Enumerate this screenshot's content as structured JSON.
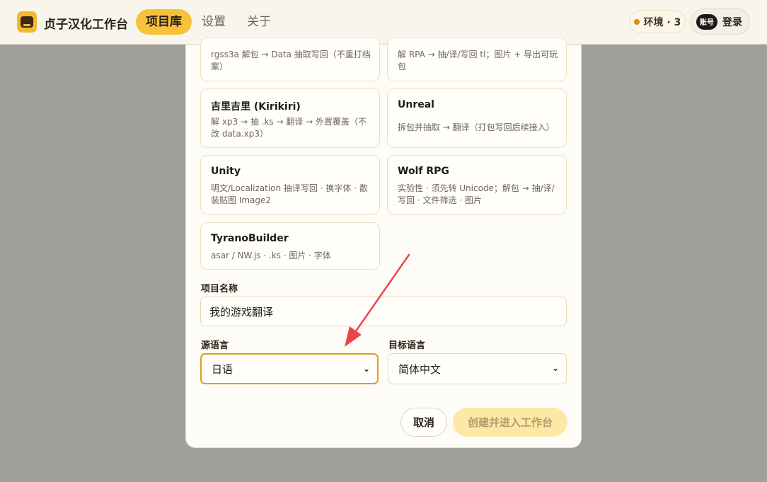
{
  "header": {
    "app_title": "贞子汉化工作台",
    "nav": [
      "项目库",
      "设置",
      "关于"
    ],
    "env_label": "环境 · 3",
    "avatar_label": "账号",
    "login_label": "登录"
  },
  "engines": [
    {
      "title": "",
      "desc": "rgss3a 解包 → Data 抽取写回（不重打档案）"
    },
    {
      "title": "",
      "desc": "解 RPA → 抽/译/写回 tl；图片 + 导出可玩包"
    },
    {
      "title": "吉里吉里 (Kirikiri)",
      "desc": "解 xp3 → 抽 .ks → 翻译 → 外置覆盖（不改 data.xp3）"
    },
    {
      "title": "Unreal",
      "desc": "拆包并抽取 → 翻译（打包写回后续接入）"
    },
    {
      "title": "Unity",
      "desc": "明文/Localization 抽译写回 · 换字体 · 散装贴图 Image2"
    },
    {
      "title": "Wolf RPG",
      "desc": "实验性 · 须先转 Unicode；解包 → 抽/译/写回 · 文件筛选 · 图片"
    },
    {
      "title": "TyranoBuilder",
      "desc": "asar / NW.js · .ks · 图片 · 字体"
    }
  ],
  "form": {
    "project_name_label": "项目名称",
    "project_name_value": "我的游戏翻译",
    "source_lang_label": "源语言",
    "source_lang_value": "日语",
    "target_lang_label": "目标语言",
    "target_lang_value": "简体中文"
  },
  "actions": {
    "cancel_label": "取消",
    "create_label": "创建并进入工作台"
  },
  "colors": {
    "accent": "#f7c23a",
    "annotation_arrow": "#e8474a",
    "focus_border": "#dba21a"
  }
}
